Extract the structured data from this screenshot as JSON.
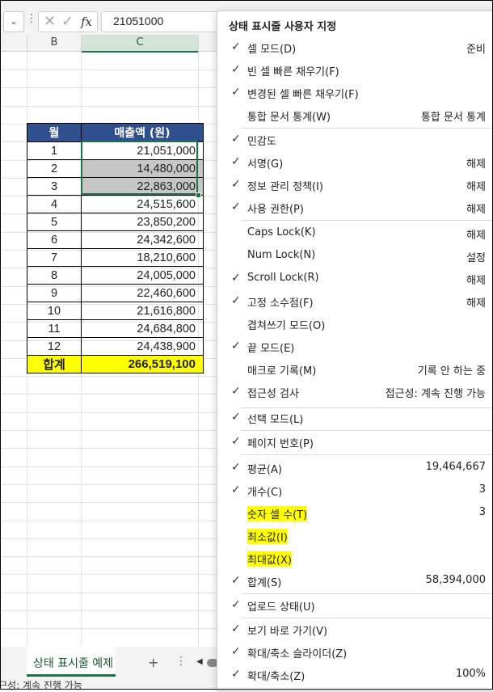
{
  "formula_bar": {
    "cancel_glyph": "✕",
    "enter_glyph": "✓",
    "fx_label": "fx",
    "value": "21051000"
  },
  "columns": [
    "B",
    "C"
  ],
  "table": {
    "headers": [
      "월",
      "매출액 (원)"
    ],
    "rows": [
      {
        "month": "1",
        "amount": "21,051,000"
      },
      {
        "month": "2",
        "amount": "14,480,000"
      },
      {
        "month": "3",
        "amount": "22,863,000"
      },
      {
        "month": "4",
        "amount": "24,515,600"
      },
      {
        "month": "5",
        "amount": "23,850,200"
      },
      {
        "month": "6",
        "amount": "24,342,600"
      },
      {
        "month": "7",
        "amount": "18,210,600"
      },
      {
        "month": "8",
        "amount": "24,005,000"
      },
      {
        "month": "9",
        "amount": "22,460,600"
      },
      {
        "month": "10",
        "amount": "21,616,800"
      },
      {
        "month": "11",
        "amount": "24,684,800"
      },
      {
        "month": "12",
        "amount": "24,438,900"
      }
    ],
    "total_label": "합계",
    "total_value": "266,519,100",
    "header_color": "#2f4f8f",
    "total_color": "#ffff00"
  },
  "sheet_tab": {
    "label": "상태 표시줄 예제",
    "add": "+",
    "more": "⋮"
  },
  "status_bar": {
    "text": "근성: 계속 진행 가능"
  },
  "menu": {
    "title": "상태 표시줄 사용자 지정",
    "items": [
      {
        "label": "셀 모드(D)",
        "value": "준비",
        "checked": true
      },
      {
        "label": "빈 셀 빠른 채우기(F)",
        "value": "",
        "checked": true
      },
      {
        "label": "변경된 셀 빠른 채우기(F)",
        "value": "",
        "checked": true
      },
      {
        "label": "통합 문서 통계(W)",
        "value": "통합 문서 통계",
        "checked": false
      },
      {
        "label": "민감도",
        "value": "",
        "checked": true
      },
      {
        "label": "서명(G)",
        "value": "해제",
        "checked": true
      },
      {
        "label": "정보 관리 정책(I)",
        "value": "해제",
        "checked": true
      },
      {
        "label": "사용 권한(P)",
        "value": "해제",
        "checked": true
      },
      {
        "label": "Caps Lock(K)",
        "value": "해제",
        "checked": false
      },
      {
        "label": "Num Lock(N)",
        "value": "설정",
        "checked": false
      },
      {
        "label": "Scroll Lock(R)",
        "value": "해제",
        "checked": true
      },
      {
        "label": "고정 소수점(F)",
        "value": "해제",
        "checked": true
      },
      {
        "label": "겹쳐쓰기 모드(O)",
        "value": "",
        "checked": false
      },
      {
        "label": "끝 모드(E)",
        "value": "",
        "checked": true
      },
      {
        "label": "매크로 기록(M)",
        "value": "기록 안 하는 중",
        "checked": false
      },
      {
        "label": "접근성 검사",
        "value": "접근성: 계속 진행 가능",
        "checked": true
      },
      {
        "label": "선택 모드(L)",
        "value": "",
        "checked": true
      },
      {
        "label": "페이지 번호(P)",
        "value": "",
        "checked": true
      },
      {
        "label": "평균(A)",
        "value": "19,464,667",
        "checked": true
      },
      {
        "label": "개수(C)",
        "value": "3",
        "checked": true
      },
      {
        "label": "숫자 셀 수(T)",
        "value": "3",
        "checked": false
      },
      {
        "label": "최소값(I)",
        "value": "",
        "checked": false
      },
      {
        "label": "최대값(X)",
        "value": "",
        "checked": false
      },
      {
        "label": "합계(S)",
        "value": "58,394,000",
        "checked": true
      },
      {
        "label": "업로드 상태(U)",
        "value": "",
        "checked": true
      },
      {
        "label": "보기 바로 가기(V)",
        "value": "",
        "checked": true
      },
      {
        "label": "확대/축소 슬라이더(Z)",
        "value": "",
        "checked": true
      },
      {
        "label": "확대/축소(Z)",
        "value": "100%",
        "checked": true
      }
    ]
  }
}
